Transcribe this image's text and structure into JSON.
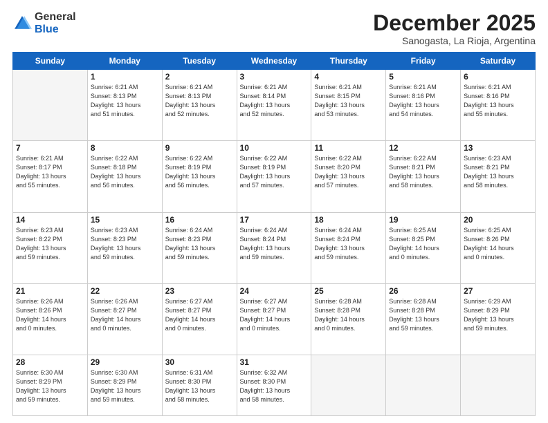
{
  "header": {
    "logo_general": "General",
    "logo_blue": "Blue",
    "month_title": "December 2025",
    "subtitle": "Sanogasta, La Rioja, Argentina"
  },
  "weekdays": [
    "Sunday",
    "Monday",
    "Tuesday",
    "Wednesday",
    "Thursday",
    "Friday",
    "Saturday"
  ],
  "weeks": [
    [
      {
        "day": "",
        "info": ""
      },
      {
        "day": "1",
        "info": "Sunrise: 6:21 AM\nSunset: 8:13 PM\nDaylight: 13 hours\nand 51 minutes."
      },
      {
        "day": "2",
        "info": "Sunrise: 6:21 AM\nSunset: 8:13 PM\nDaylight: 13 hours\nand 52 minutes."
      },
      {
        "day": "3",
        "info": "Sunrise: 6:21 AM\nSunset: 8:14 PM\nDaylight: 13 hours\nand 52 minutes."
      },
      {
        "day": "4",
        "info": "Sunrise: 6:21 AM\nSunset: 8:15 PM\nDaylight: 13 hours\nand 53 minutes."
      },
      {
        "day": "5",
        "info": "Sunrise: 6:21 AM\nSunset: 8:16 PM\nDaylight: 13 hours\nand 54 minutes."
      },
      {
        "day": "6",
        "info": "Sunrise: 6:21 AM\nSunset: 8:16 PM\nDaylight: 13 hours\nand 55 minutes."
      }
    ],
    [
      {
        "day": "7",
        "info": "Sunrise: 6:21 AM\nSunset: 8:17 PM\nDaylight: 13 hours\nand 55 minutes."
      },
      {
        "day": "8",
        "info": "Sunrise: 6:22 AM\nSunset: 8:18 PM\nDaylight: 13 hours\nand 56 minutes."
      },
      {
        "day": "9",
        "info": "Sunrise: 6:22 AM\nSunset: 8:19 PM\nDaylight: 13 hours\nand 56 minutes."
      },
      {
        "day": "10",
        "info": "Sunrise: 6:22 AM\nSunset: 8:19 PM\nDaylight: 13 hours\nand 57 minutes."
      },
      {
        "day": "11",
        "info": "Sunrise: 6:22 AM\nSunset: 8:20 PM\nDaylight: 13 hours\nand 57 minutes."
      },
      {
        "day": "12",
        "info": "Sunrise: 6:22 AM\nSunset: 8:21 PM\nDaylight: 13 hours\nand 58 minutes."
      },
      {
        "day": "13",
        "info": "Sunrise: 6:23 AM\nSunset: 8:21 PM\nDaylight: 13 hours\nand 58 minutes."
      }
    ],
    [
      {
        "day": "14",
        "info": "Sunrise: 6:23 AM\nSunset: 8:22 PM\nDaylight: 13 hours\nand 59 minutes."
      },
      {
        "day": "15",
        "info": "Sunrise: 6:23 AM\nSunset: 8:23 PM\nDaylight: 13 hours\nand 59 minutes."
      },
      {
        "day": "16",
        "info": "Sunrise: 6:24 AM\nSunset: 8:23 PM\nDaylight: 13 hours\nand 59 minutes."
      },
      {
        "day": "17",
        "info": "Sunrise: 6:24 AM\nSunset: 8:24 PM\nDaylight: 13 hours\nand 59 minutes."
      },
      {
        "day": "18",
        "info": "Sunrise: 6:24 AM\nSunset: 8:24 PM\nDaylight: 13 hours\nand 59 minutes."
      },
      {
        "day": "19",
        "info": "Sunrise: 6:25 AM\nSunset: 8:25 PM\nDaylight: 14 hours\nand 0 minutes."
      },
      {
        "day": "20",
        "info": "Sunrise: 6:25 AM\nSunset: 8:26 PM\nDaylight: 14 hours\nand 0 minutes."
      }
    ],
    [
      {
        "day": "21",
        "info": "Sunrise: 6:26 AM\nSunset: 8:26 PM\nDaylight: 14 hours\nand 0 minutes."
      },
      {
        "day": "22",
        "info": "Sunrise: 6:26 AM\nSunset: 8:27 PM\nDaylight: 14 hours\nand 0 minutes."
      },
      {
        "day": "23",
        "info": "Sunrise: 6:27 AM\nSunset: 8:27 PM\nDaylight: 14 hours\nand 0 minutes."
      },
      {
        "day": "24",
        "info": "Sunrise: 6:27 AM\nSunset: 8:27 PM\nDaylight: 14 hours\nand 0 minutes."
      },
      {
        "day": "25",
        "info": "Sunrise: 6:28 AM\nSunset: 8:28 PM\nDaylight: 14 hours\nand 0 minutes."
      },
      {
        "day": "26",
        "info": "Sunrise: 6:28 AM\nSunset: 8:28 PM\nDaylight: 13 hours\nand 59 minutes."
      },
      {
        "day": "27",
        "info": "Sunrise: 6:29 AM\nSunset: 8:29 PM\nDaylight: 13 hours\nand 59 minutes."
      }
    ],
    [
      {
        "day": "28",
        "info": "Sunrise: 6:30 AM\nSunset: 8:29 PM\nDaylight: 13 hours\nand 59 minutes."
      },
      {
        "day": "29",
        "info": "Sunrise: 6:30 AM\nSunset: 8:29 PM\nDaylight: 13 hours\nand 59 minutes."
      },
      {
        "day": "30",
        "info": "Sunrise: 6:31 AM\nSunset: 8:30 PM\nDaylight: 13 hours\nand 58 minutes."
      },
      {
        "day": "31",
        "info": "Sunrise: 6:32 AM\nSunset: 8:30 PM\nDaylight: 13 hours\nand 58 minutes."
      },
      {
        "day": "",
        "info": ""
      },
      {
        "day": "",
        "info": ""
      },
      {
        "day": "",
        "info": ""
      }
    ]
  ]
}
